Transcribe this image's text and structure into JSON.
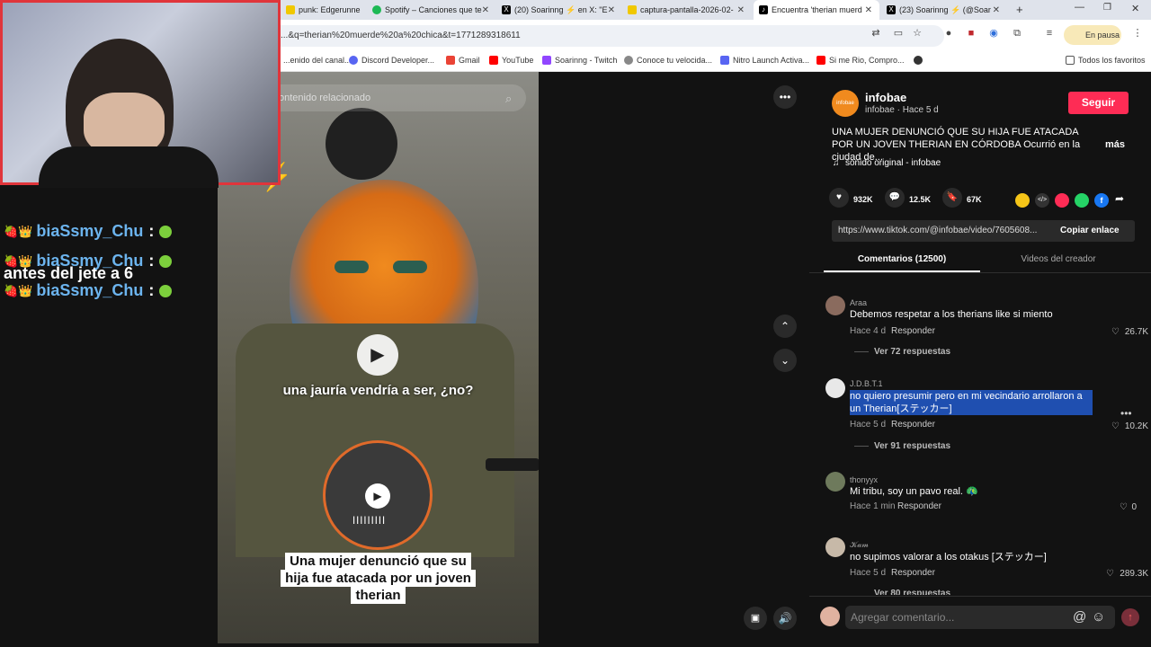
{
  "browser": {
    "tabs": [
      {
        "label": "punk: Edgerunne",
        "color": "#f0c800"
      },
      {
        "label": "Spotify – Canciones que te",
        "color": "#1db954"
      },
      {
        "label": "(20) Soarinng ⚡ en X: \"E",
        "color": "#000000"
      },
      {
        "label": "captura-pantalla-2026-02-",
        "color": "#f0c800"
      },
      {
        "label": "Encuentra 'therian muerd",
        "color": "#000000"
      },
      {
        "label": "(23) Soarinng ⚡ (@Soar",
        "color": "#000000"
      }
    ],
    "url": "...&q=therian%20muerde%20a%20chica&t=1771289318611",
    "pause_label": "En pausa",
    "bookmarks": [
      {
        "label": "...enido del canal...",
        "color": "#888888"
      },
      {
        "label": "Discord Developer...",
        "color": "#5865f2"
      },
      {
        "label": "Gmail",
        "color": "#ea4335"
      },
      {
        "label": "YouTube",
        "color": "#ff0000"
      },
      {
        "label": "Soarinng - Twitch",
        "color": "#9146ff"
      },
      {
        "label": "Conoce tu velocida...",
        "color": "#888888"
      },
      {
        "label": "Nitro Launch Activa...",
        "color": "#5865f2"
      },
      {
        "label": "Si me Rio, Compro...",
        "color": "#ff0000"
      }
    ],
    "all_bookmarks": "Todos los favoritos"
  },
  "overlay": {
    "chat_header": "antes del jete a 6",
    "chat": [
      {
        "user": "biaSsmy_Chu",
        "colon": ":"
      },
      {
        "user": "biaSsmy_Chu",
        "colon": ":"
      },
      {
        "user": "biaSsmy_Chu",
        "colon": ":"
      }
    ]
  },
  "video": {
    "search_placeholder": "ontenido relacionado",
    "subtitle": "una jauría vendría a ser, ¿no?",
    "caption": "Una mujer denunció que su hija fue atacada por un joven therian"
  },
  "post": {
    "account": "infobae",
    "account_meta": "infobae · Hace 5 d",
    "follow_label": "Seguir",
    "description": "UNA MUJER DENUNCIÓ QUE SU HIJA FUE ATACADA POR UN JOVEN THERIAN EN CÓRDOBA Ocurrió en la ciudad de...",
    "more_label": "más",
    "sound": "sonido original - infobae",
    "likes": "932K",
    "comments": "12.5K",
    "saves": "67K",
    "link": "https://www.tiktok.com/@infobae/video/7605608...",
    "copy_label": "Copiar enlace",
    "tab_comments": "Comentarios (12500)",
    "tab_creator": "Videos del creador",
    "add_comment_placeholder": "Agregar comentario..."
  },
  "comments": [
    {
      "user": "Araa",
      "text": "Debemos respetar a los therians like si miento",
      "time": "Hace 4 d",
      "reply": "Responder",
      "likes": "26.7K",
      "replies": "Ver 72 respuestas"
    },
    {
      "user": "J.D.B.T.1",
      "text": "no quiero presumir pero en mi vecindario arrollaron a un Therian[ステッカー]",
      "time": "Hace 5 d",
      "reply": "Responder",
      "likes": "10.2K",
      "replies": "Ver 91 respuestas"
    },
    {
      "user": "thonyyx",
      "text": "Mi tribu, soy un pavo real. 🦚",
      "time": "Hace 1 min",
      "reply": "Responder",
      "likes": "0",
      "replies": ""
    },
    {
      "user": "𝒦𝒶𝓂",
      "text": "no supimos valorar a los otakus [ステッカー]",
      "time": "Hace 5 d",
      "reply": "Responder",
      "likes": "289.3K",
      "replies": "Ver 80 respuestas"
    }
  ]
}
